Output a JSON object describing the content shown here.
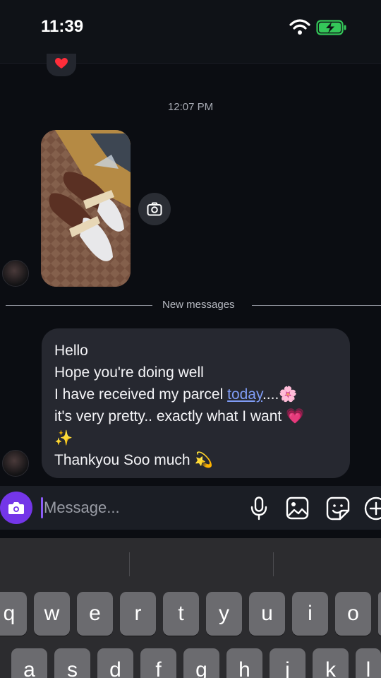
{
  "status_bar": {
    "time": "11:39",
    "icons": [
      "wifi-icon",
      "battery-charging-icon"
    ],
    "battery_color": "#34c759"
  },
  "chat": {
    "reaction": "heart-icon",
    "timestamp": "12:07 PM",
    "photo": "photo-attachment",
    "divider_label": "New messages",
    "message_lines": [
      "Hello",
      "Hope you're doing well",
      "I have received my parcel ",
      "today",
      "....🌸",
      "it's very pretty.. exactly what I want 💗",
      "✨",
      "Thankyou Soo much 💫"
    ],
    "link_color": "#7f9cf5"
  },
  "composer": {
    "placeholder": "Message...",
    "accent_color": "#7436e8",
    "tools": [
      "microphone-icon",
      "image-icon",
      "sticker-icon",
      "plus-icon"
    ]
  },
  "keyboard": {
    "row1": [
      "q",
      "w",
      "e",
      "r",
      "t",
      "y",
      "u",
      "i",
      "o"
    ],
    "row2": [
      "a",
      "s",
      "d",
      "f",
      "g",
      "h",
      "j",
      "k",
      "l"
    ]
  }
}
